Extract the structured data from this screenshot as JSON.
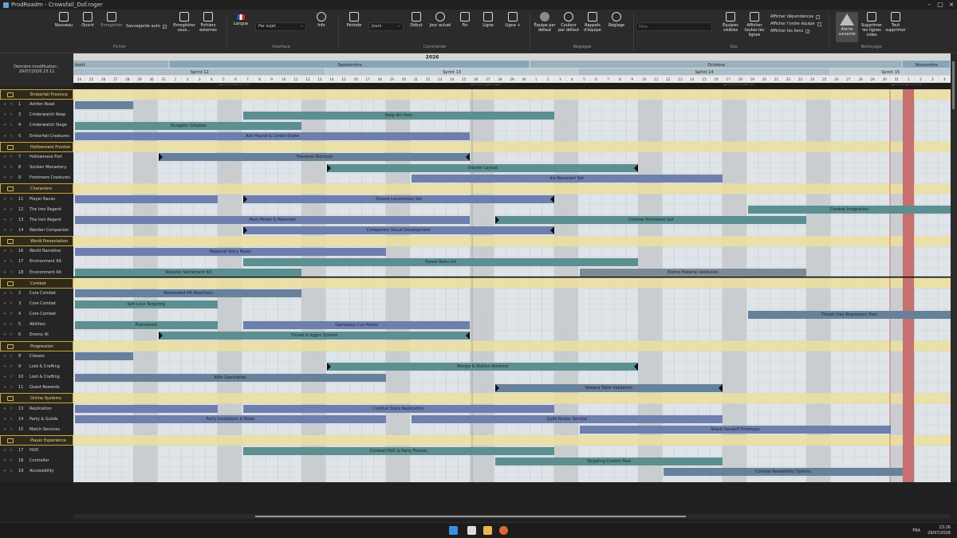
{
  "window": {
    "title": "ProdRoadm - Crowsfall_Dof.roger",
    "controls": [
      "–",
      "□",
      "×"
    ]
  },
  "ribbon": {
    "buttons": [
      {
        "id": "nouveau",
        "label": "Nouveau",
        "icon": "new-file-icon"
      },
      {
        "id": "ouvrir",
        "label": "Ouvrir",
        "icon": "folder-icon"
      },
      {
        "id": "enregistrer",
        "label": "Enregistrer",
        "icon": "save-icon",
        "state": "dim"
      },
      {
        "id": "enregistrer-sous",
        "label": "Enregistrer sous...",
        "icon": "save-as-icon"
      },
      {
        "id": "fichiers-externes",
        "label": "Fichiers externes",
        "icon": "external-files-icon"
      },
      {
        "id": "langue",
        "label": "Langue",
        "icon": "flag-icon"
      },
      {
        "id": "info",
        "label": "Info",
        "icon": "info-icon"
      },
      {
        "id": "periode",
        "label": "Période",
        "icon": "calendar-icon"
      },
      {
        "id": "debut",
        "label": "Début",
        "icon": "skip-start-icon"
      },
      {
        "id": "jour-actuel",
        "label": "Jour actuel",
        "icon": "target-icon"
      },
      {
        "id": "fin",
        "label": "Fin",
        "icon": "skip-end-icon"
      },
      {
        "id": "ligne-minus",
        "label": "Ligne",
        "icon": "row-remove-icon"
      },
      {
        "id": "ligne-plus",
        "label": "Ligne +",
        "icon": "row-add-icon"
      },
      {
        "id": "equipe-defaut",
        "label": "Équipe par défaut",
        "icon": "team-circle-icon"
      },
      {
        "id": "couleur-defaut",
        "label": "Couleur par défaut",
        "icon": "palette-icon"
      },
      {
        "id": "rappels",
        "label": "Rappels d'équipe",
        "icon": "note-icon"
      },
      {
        "id": "reglage",
        "label": "Réglage",
        "icon": "gear-icon"
      },
      {
        "id": "equipes-visibles",
        "label": "Équipes visibles",
        "icon": "people-icon"
      },
      {
        "id": "afficher-lignes",
        "label": "Afficher toutes les lignes",
        "icon": "list-icon"
      },
      {
        "id": "alerte-suivante",
        "label": "Alerte suivante",
        "icon": "warning-icon",
        "state": "active"
      },
      {
        "id": "supprimer-vides",
        "label": "Supprimer les lignes vides",
        "icon": "delete-rows-icon"
      },
      {
        "id": "tout-supprimer",
        "label": "Tout supprimer",
        "icon": "delete-all-icon"
      }
    ],
    "autosave_label": "Sauvegarde auto",
    "autosave_checked": "✓",
    "subject_select": "Par sujet",
    "period_select": "Jours",
    "search_placeholder": "Filtre",
    "checks": [
      {
        "label": "Afficher dépendances",
        "value": ""
      },
      {
        "label": "Afficher l'ordre équipe",
        "value": ""
      },
      {
        "label": "Afficher les liens",
        "value": "✓"
      }
    ],
    "groups": [
      "Fichier",
      "Interface",
      "Commande",
      "Réglages",
      "Vue",
      "Nettoyage"
    ]
  },
  "left": {
    "last_modified_label": "Dernière modification :",
    "last_modified_value": "29/07/2026 23:11"
  },
  "timeline": {
    "year": "2026",
    "months": [
      "Août",
      "Septembre",
      "Octobre",
      "Novembre"
    ],
    "sprints": [
      "Sprint 12",
      "Sprint 13",
      "Sprint 14",
      "Sprint 15"
    ],
    "days": [
      "24",
      "25",
      "26",
      "27",
      "28",
      "29",
      "30",
      "31",
      "1",
      "2",
      "3",
      "4",
      "5",
      "6",
      "7",
      "8",
      "9",
      "10",
      "11",
      "12",
      "13",
      "14",
      "15",
      "16",
      "17",
      "18",
      "19",
      "20",
      "21",
      "22",
      "23",
      "24",
      "25",
      "26",
      "27",
      "28",
      "29",
      "30",
      "1",
      "2",
      "3",
      "4",
      "5",
      "6",
      "7",
      "8",
      "9",
      "10",
      "11",
      "12",
      "13",
      "14",
      "15",
      "16",
      "17",
      "18",
      "19",
      "20",
      "21",
      "22",
      "23",
      "24",
      "25",
      "26",
      "27",
      "28",
      "29",
      "30",
      "31",
      "1",
      "2",
      "3",
      "4"
    ],
    "milestones": [
      "Combat Playtest",
      "Network Soak Test",
      "Progression Review",
      "Feature Branch Lock"
    ]
  },
  "rows": [
    {
      "type": "group",
      "name": "Emberfall Province",
      "icon": "folder-icon"
    },
    {
      "num": "1",
      "name": "Ashfen Road",
      "bars": [
        {
          "s": 0,
          "e": 5,
          "label": "",
          "c": "slate"
        }
      ]
    },
    {
      "num": "3",
      "name": "Cinderwatch Keep",
      "bars": [
        {
          "s": 14,
          "e": 40,
          "label": "Keep Art Pass",
          "c": "teal"
        }
      ]
    },
    {
      "num": "4",
      "name": "Cinderwatch Siege",
      "bars": [
        {
          "s": 0,
          "e": 19,
          "label": "Dungeon Greybox",
          "c": "teal"
        }
      ]
    },
    {
      "num": "5",
      "name": "Emberfall Creatures",
      "bars": [
        {
          "s": 0,
          "e": 33,
          "label": "Ash Hound & Cinder Drake",
          "c": "blue"
        }
      ]
    },
    {
      "type": "group",
      "name": "Hollowmere Frontier",
      "icon": "folder-icon"
    },
    {
      "num": "7",
      "name": "Hollowmere Fort",
      "bars": [
        {
          "s": 7,
          "e": 33,
          "label": "Traversal Blockout",
          "c": "slate",
          "lc": true,
          "rc": true
        }
      ]
    },
    {
      "num": "8",
      "name": "Sunken Monastery",
      "bars": [
        {
          "s": 21,
          "e": 47,
          "label": "Interior Layout",
          "c": "teal",
          "lc": true,
          "rc": true
        }
      ]
    },
    {
      "num": "9",
      "name": "Frostmere Creatures",
      "bars": [
        {
          "s": 28,
          "e": 54,
          "label": "Ice Revenant Set",
          "c": "blue"
        }
      ]
    },
    {
      "type": "group",
      "name": "Characters",
      "icon": "folder-icon"
    },
    {
      "num": "11",
      "name": "Player Races",
      "bars": [
        {
          "s": 0,
          "e": 12,
          "label": "",
          "c": "blue"
        },
        {
          "s": 14,
          "e": 40,
          "label": "Shared Locomotion Set",
          "c": "blue",
          "lc": true,
          "rc": true
        }
      ]
    },
    {
      "num": "12",
      "name": "The Iron Regent",
      "bars": [
        {
          "s": 56,
          "e": 73,
          "label": "Combat Integration",
          "c": "teal"
        }
      ]
    },
    {
      "num": "13",
      "name": "The Iron Regent",
      "bars": [
        {
          "s": 0,
          "e": 33,
          "label": "Hero Model & Materials",
          "c": "blue"
        },
        {
          "s": 35,
          "e": 61,
          "label": "Combat Animation Set",
          "c": "teal",
          "lc": true
        }
      ]
    },
    {
      "num": "14",
      "name": "Warden Companion",
      "bars": [
        {
          "s": 14,
          "e": 40,
          "label": "Companion Visual Development",
          "c": "blue",
          "lc": true,
          "rc": true
        }
      ]
    },
    {
      "type": "group",
      "name": "World Presentation",
      "icon": "folder-icon"
    },
    {
      "num": "16",
      "name": "World Narrative",
      "bars": [
        {
          "s": 0,
          "e": 26,
          "label": "Regional Story Beats",
          "c": "blue"
        }
      ]
    },
    {
      "num": "17",
      "name": "Environment Kit",
      "bars": [
        {
          "s": 14,
          "e": 47,
          "label": "Forest Ruins Kit",
          "c": "teal"
        }
      ]
    },
    {
      "num": "18",
      "name": "Environment Kit",
      "bars": [
        {
          "s": 0,
          "e": 19,
          "label": "Volcanic Settlement Kit",
          "c": "teal"
        },
        {
          "s": 42,
          "e": 61,
          "label": "Biome Material Validation",
          "c": "grey"
        }
      ]
    },
    {
      "type": "group",
      "name": "Combat",
      "icon": "folder-icon"
    },
    {
      "num": "2",
      "name": "Core Combat",
      "bars": [
        {
          "s": 0,
          "e": 19,
          "label": "Networked Hit Reactions",
          "c": "slate"
        }
      ]
    },
    {
      "num": "3",
      "name": "Core Combat",
      "bars": [
        {
          "s": 0,
          "e": 12,
          "label": "Soft Lock Targeting",
          "c": "teal"
        }
      ]
    },
    {
      "num": "4",
      "name": "Core Combat",
      "bars": [
        {
          "s": 56,
          "e": 73,
          "label": "Threat Cleo Regression Pass",
          "c": "slate"
        }
      ]
    },
    {
      "num": "5",
      "name": "Abilities",
      "bars": [
        {
          "s": 0,
          "e": 12,
          "label": "Framework",
          "c": "teal"
        },
        {
          "s": 14,
          "e": 33,
          "label": "Gameplay Cue Hooks",
          "c": "blue"
        }
      ]
    },
    {
      "num": "6",
      "name": "Enemy AI",
      "bars": [
        {
          "s": 7,
          "e": 33,
          "label": "Threat & Aggro System",
          "c": "teal",
          "lc": true,
          "rc": true
        }
      ]
    },
    {
      "type": "group",
      "name": "Progression",
      "icon": "folder-icon"
    },
    {
      "num": "8",
      "name": "Classes",
      "bars": [
        {
          "s": 0,
          "e": 5,
          "label": "",
          "c": "slate"
        }
      ]
    },
    {
      "num": "9",
      "name": "Loot & Crafting",
      "bars": [
        {
          "s": 21,
          "e": 47,
          "label": "Recipe & Station Runtime",
          "c": "teal",
          "lc": true,
          "rc": true
        }
      ]
    },
    {
      "num": "10",
      "name": "Loot & Crafting",
      "bars": [
        {
          "s": 0,
          "e": 26,
          "label": "Affix Generation",
          "c": "slate"
        }
      ]
    },
    {
      "num": "11",
      "name": "Quest Rewards",
      "bars": [
        {
          "s": 35,
          "e": 54,
          "label": "Reward Table Validation",
          "c": "slate",
          "lc": true,
          "rc": true
        }
      ]
    },
    {
      "type": "group",
      "name": "Online Systems",
      "icon": "folder-icon"
    },
    {
      "num": "13",
      "name": "Replication",
      "bars": [
        {
          "s": 0,
          "e": 12,
          "label": "",
          "c": "blue"
        },
        {
          "s": 14,
          "e": 40,
          "label": "Combat State Replication",
          "c": "blue"
        }
      ]
    },
    {
      "num": "14",
      "name": "Party & Guilds",
      "bars": [
        {
          "s": 0,
          "e": 26,
          "label": "Party Invitations & Roles",
          "c": "blue"
        },
        {
          "s": 28,
          "e": 54,
          "label": "Guild Roster Service",
          "c": "blue"
        }
      ]
    },
    {
      "num": "15",
      "name": "Match Services",
      "bars": [
        {
          "s": 42,
          "e": 68,
          "label": "Shard Handoff Prototype",
          "c": "blue"
        }
      ]
    },
    {
      "type": "group",
      "name": "Player Experience",
      "icon": "folder-icon"
    },
    {
      "num": "17",
      "name": "HUD",
      "bars": [
        {
          "s": 14,
          "e": 40,
          "label": "Combat HUD & Party Frames",
          "c": "teal"
        }
      ]
    },
    {
      "num": "18",
      "name": "Controller",
      "bars": [
        {
          "s": 35,
          "e": 54,
          "label": "Targeting Control Pass",
          "c": "teal"
        }
      ]
    },
    {
      "num": "19",
      "name": "Accessibility",
      "bars": [
        {
          "s": 49,
          "e": 69,
          "label": "Combat Readability Options",
          "c": "slate"
        }
      ]
    }
  ],
  "taskbar": {
    "lang": "FRA",
    "time": "23:26",
    "date": "29/07/2026"
  }
}
